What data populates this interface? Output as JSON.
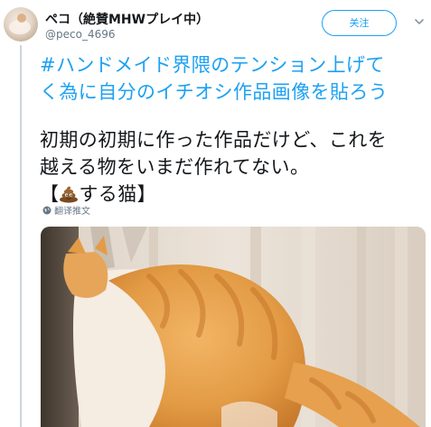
{
  "user": {
    "display_name": "ペコ（絶賛MHWプレイ中）",
    "handle": "@peco_4696"
  },
  "follow_button_label": "关注",
  "tweet": {
    "hashtag_line1": "#ハンドメイド界隈のテンション上げて",
    "hashtag_line2": "く為に自分のイチオシ作品画像を貼ろう",
    "body_line1": "初期の初期に作った作品だけど、これを",
    "body_line2": "越える物をいまだ作れてない。",
    "body_bracket_open": "【",
    "body_bracket_text": "する猫】",
    "translate_label": "翻译推文"
  },
  "icons": {
    "avatar": "avatar",
    "chevron": "chevron-down-icon",
    "emoji": "pile-of-poo-emoji",
    "globe": "globe-icon"
  },
  "colors": {
    "link": "#1da1f2",
    "text": "#14171a",
    "muted": "#657786",
    "divider": "#ccd6dd"
  }
}
